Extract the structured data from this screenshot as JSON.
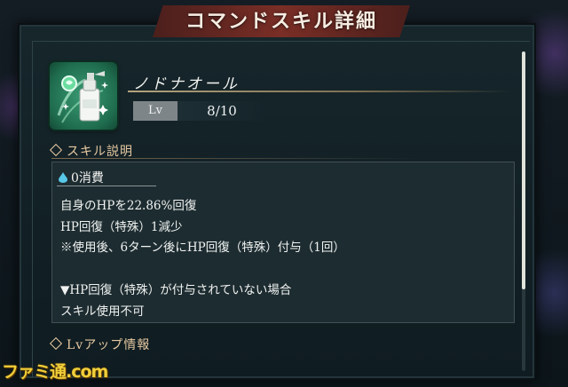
{
  "window": {
    "title": "コマンドスキル詳細"
  },
  "skill": {
    "name": "ノドナオール",
    "lv_label": "Lv",
    "lv_value": "8/10",
    "icon": "healing-spray-bottle-icon"
  },
  "description_section": {
    "header": "スキル説明",
    "cost": "0消費",
    "lines": [
      "自身のHPを22.86%回復",
      "HP回復（特殊）1減少",
      "※使用後、6ターン後にHP回復（特殊）付与（1回）",
      "",
      "▼HP回復（特殊）が付与されていない場合",
      "スキル使用不可"
    ]
  },
  "lvup_section": {
    "header": "Lvアップ情報"
  },
  "watermark": {
    "text": "ファミ通.com"
  },
  "colors": {
    "accent_gold": "#e7c9a1",
    "banner_red": "#7a2e26",
    "panel_bg": "#16262b"
  }
}
